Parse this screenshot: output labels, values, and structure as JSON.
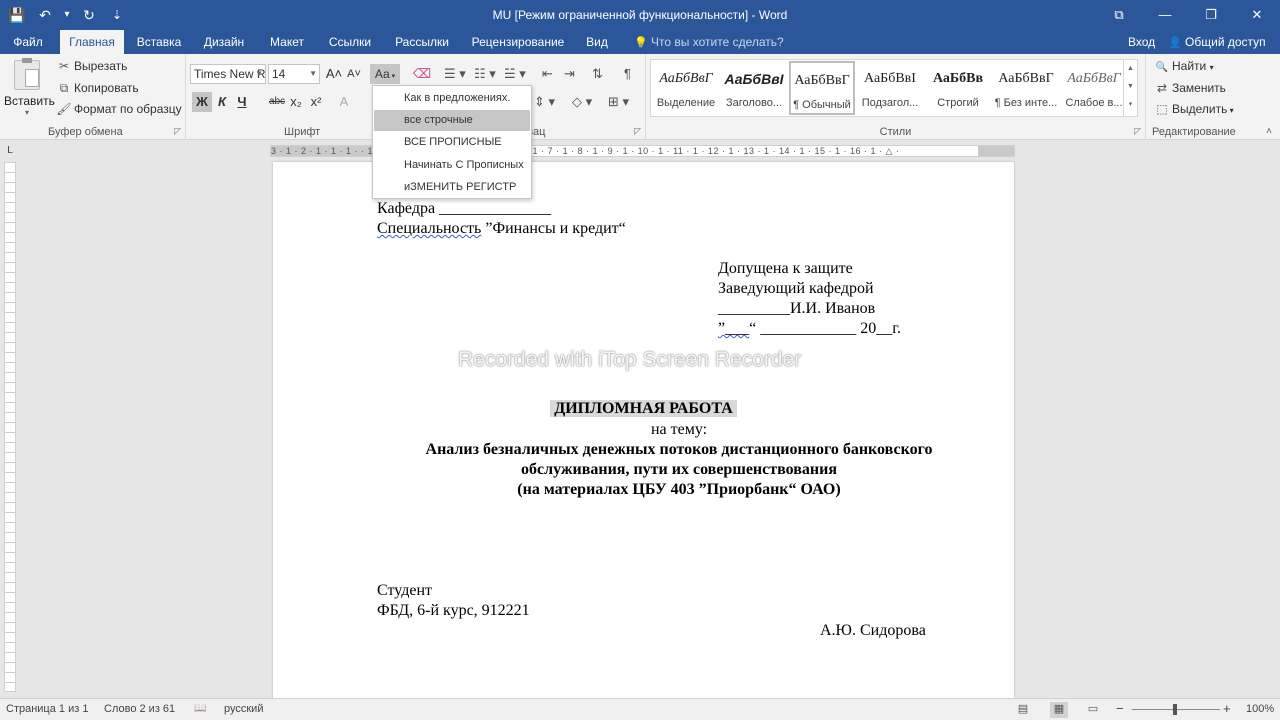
{
  "titlebar": {
    "title": "MU [Режим ограниченной функциональности] - Word",
    "qat": {
      "save_icon": "💾",
      "undo_icon": "↶",
      "undo_dd": "▾",
      "redo_icon": "↻",
      "customize_icon": "⇣"
    },
    "winbtns": {
      "ribbon_opts": "⧉",
      "minimize": "—",
      "restore": "❐",
      "close": "✕"
    }
  },
  "tabs": [
    {
      "label": "Файл"
    },
    {
      "label": "Главная"
    },
    {
      "label": "Вставка"
    },
    {
      "label": "Дизайн"
    },
    {
      "label": "Макет"
    },
    {
      "label": "Ссылки"
    },
    {
      "label": "Рассылки"
    },
    {
      "label": "Рецензирование"
    },
    {
      "label": "Вид"
    }
  ],
  "tellme": "Что вы хотите сделать?",
  "tellme_icon": "💡",
  "signin": "Вход",
  "share": "Общий доступ",
  "share_icon": "👤",
  "clipboard": {
    "paste": "Вставить",
    "paste_dd": "▾",
    "cut": "Вырезать",
    "copy": "Копировать",
    "format_painter": "Формат по образцу",
    "label": "Буфер обмена"
  },
  "font": {
    "name": "Times New R",
    "size": "14",
    "grow": "A˄",
    "shrink": "A˅",
    "change_case": "Аа",
    "clear": "⌫",
    "bold": "Ж",
    "italic": "К",
    "underline": "Ч",
    "strike": "abc",
    "sub": "x₂",
    "sup": "x²",
    "effects": "A",
    "label": "Шрифт"
  },
  "paragraph": {
    "label": "Абзац",
    "label_visible": "зац"
  },
  "styles": {
    "items": [
      {
        "preview": "АаБбВвГ",
        "name": "Выделение"
      },
      {
        "preview": "АаБбВвІ",
        "name": "Заголово..."
      },
      {
        "preview": "АаБбВвГ",
        "name": "¶ Обычный"
      },
      {
        "preview": "АаБбВвІ",
        "name": "Подзагол..."
      },
      {
        "preview": "АаБбВв",
        "name": "Строгий"
      },
      {
        "preview": "АаБбВвГ",
        "name": "¶ Без инте..."
      },
      {
        "preview": "АаБбВвГ",
        "name": "Слабое в..."
      }
    ],
    "label": "Стили"
  },
  "editing": {
    "find": "Найти",
    "replace": "Заменить",
    "select": "Выделить",
    "label": "Редактирование",
    "find_icon": "🔍",
    "replace_icon": "⇄",
    "select_icon": "⬚"
  },
  "case_menu": {
    "items": [
      "Как в предложениях.",
      "все строчные",
      "ВСЕ ПРОПИСНЫЕ",
      "Начинать С Прописных",
      "иЗМЕНИТЬ РЕГИСТР"
    ],
    "hover_index": 1
  },
  "ruler": {
    "marks": "3 · 1 · 2 · 1 · 1 · 1 ·   · 1 · 1 · 2 · 1 · 3 · 1 · 4 · 1 · 5 · 1 · 6 · 1 · 7 · 1 · 8 · 1 · 9 · 1 · 10 · 1 · 11 · 1 · 12 · 1 · 13 · 1 · 14 · 1 · 15 · 1 · 16 · 1 · △ ·",
    "tab_selector": "L"
  },
  "document": {
    "dept_label": "Кафедра ",
    "dept_blank": "______________",
    "spec_word": "Специальность",
    "spec_rest": " ”Финансы и кредит“",
    "approve1": "Допущена к защите",
    "approve2": "Заведующий кафедрой",
    "approve3": "_________И.И. Иванов",
    "approve4_q": "”___",
    "approve4_rest": "“ ____________ 20__г.",
    "watermark": "Recorded with iTop Screen Recorder",
    "thesis_title": "ДИПЛОМНАЯ РАБОТА",
    "on_topic": "на тему:",
    "topic1": "Анализ безналичных денежных потоков дистанционного банковского",
    "topic2": "обслуживания, пути их совершенствования",
    "topic3": "(на материалах ЦБУ 403 ”Приорбанк“ ОАО)",
    "student_label": "Студент",
    "student_info": "ФБД, 6-й курс, 912221",
    "student_name": "А.Ю. Сидорова"
  },
  "statusbar": {
    "page": "Страница 1 из 1",
    "words": "Слово 2 из 61",
    "proof_icon": "📖",
    "lang": "русский",
    "zoom": "100%",
    "zoom_minus": "−",
    "zoom_plus": "+",
    "view_read": "▤",
    "view_print": "▦",
    "view_web": "▭"
  },
  "colors": {
    "accent": "#2b579a",
    "ribbon_bg": "#f3f3f3",
    "hover": "#c6c6c6"
  }
}
